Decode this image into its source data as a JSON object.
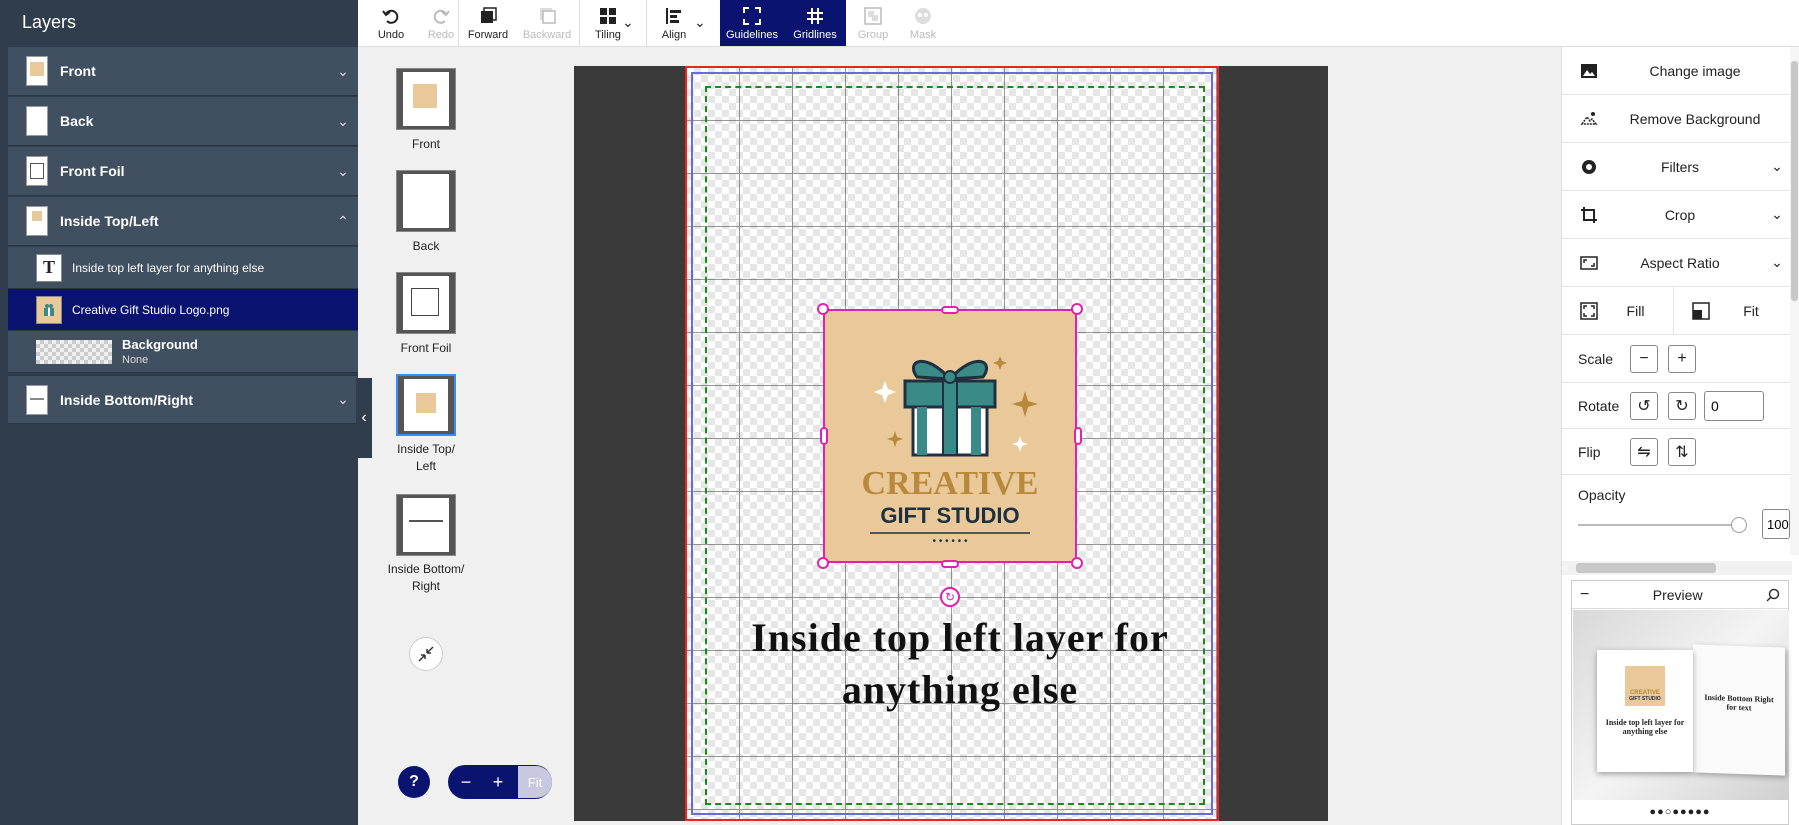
{
  "layers": {
    "title": "Layers",
    "groups": [
      {
        "label": "Front",
        "chevron": "⌄"
      },
      {
        "label": "Back",
        "chevron": "⌄"
      },
      {
        "label": "Front Foil",
        "chevron": "⌄"
      },
      {
        "label": "Inside Top/Left",
        "chevron": "⌃"
      },
      {
        "label": "Inside Bottom/Right",
        "chevron": "⌄"
      }
    ],
    "children": [
      {
        "label": "Inside top left layer for anything else",
        "icon": "T"
      },
      {
        "label": "Creative Gift Studio Logo.png"
      },
      {
        "label": "Background",
        "sub": "None"
      }
    ]
  },
  "toolbar": {
    "undo": "Undo",
    "redo": "Redo",
    "forward": "Forward",
    "backward": "Backward",
    "tiling": "Tiling",
    "align": "Align",
    "guidelines": "Guidelines",
    "gridlines": "Gridlines",
    "group": "Group",
    "mask": "Mask"
  },
  "pages": [
    {
      "label": "Front"
    },
    {
      "label": "Back"
    },
    {
      "label": "Front Foil"
    },
    {
      "label": "Inside Top/ Left"
    },
    {
      "label": "Inside Bottom/ Right"
    }
  ],
  "zoom": {
    "minus": "−",
    "plus": "+",
    "fit": "Fit",
    "help": "?"
  },
  "canvas": {
    "text": "Inside top left layer for anything else",
    "logo": {
      "line1": "CREATIVE",
      "line2": "GIFT STUDIO",
      "dots": "• • • • • •"
    }
  },
  "right": {
    "change_image": "Change image",
    "remove_bg": "Remove Background",
    "filters": "Filters",
    "crop": "Crop",
    "aspect_ratio": "Aspect Ratio",
    "fill": "Fill",
    "fit": "Fit",
    "scale": "Scale",
    "rotate": "Rotate",
    "rotate_value": "0",
    "flip": "Flip",
    "opacity": "Opacity",
    "opacity_value": "100"
  },
  "preview": {
    "title": "Preview",
    "collapse": "−",
    "left_text": "Inside top left layer for anything else",
    "right_text": "Inside Bottom Right for text",
    "logo1": "CREATIVE",
    "logo2": "GIFT STUDIO",
    "dots": "●●○●●●●●"
  },
  "colors": {
    "accent": "#0a1470",
    "panel": "#2f3d4c",
    "selection": "#e020b0"
  }
}
